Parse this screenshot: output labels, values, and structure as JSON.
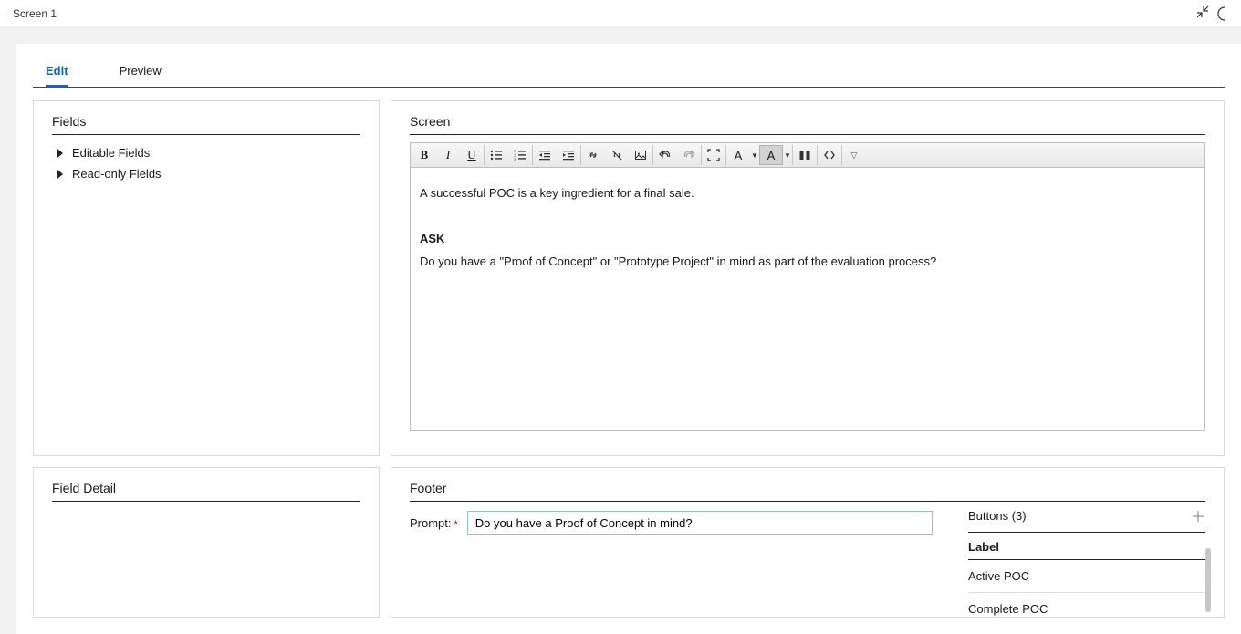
{
  "topbar": {
    "title": "Screen 1"
  },
  "tabs": {
    "edit": "Edit",
    "preview": "Preview"
  },
  "fields_panel": {
    "title": "Fields",
    "items": [
      "Editable Fields",
      "Read-only Fields"
    ]
  },
  "field_detail_panel": {
    "title": "Field Detail"
  },
  "screen_panel": {
    "title": "Screen",
    "body": {
      "line1": "A successful POC is a key ingredient for a final sale.",
      "ask_label": "ASK",
      "ask_text": "Do you have a \"Proof of Concept\" or \"Prototype Project\" in  mind as part of the evaluation process?"
    }
  },
  "footer_panel": {
    "title": "Footer",
    "prompt_label": "Prompt:",
    "prompt_value": "Do you have a Proof of Concept in mind?",
    "buttons_header": "Buttons (3)",
    "label_header": "Label",
    "buttons": [
      "Active POC",
      "Complete POC"
    ]
  },
  "toolbar": {
    "bold": "B",
    "italic": "I",
    "underline": "U"
  }
}
